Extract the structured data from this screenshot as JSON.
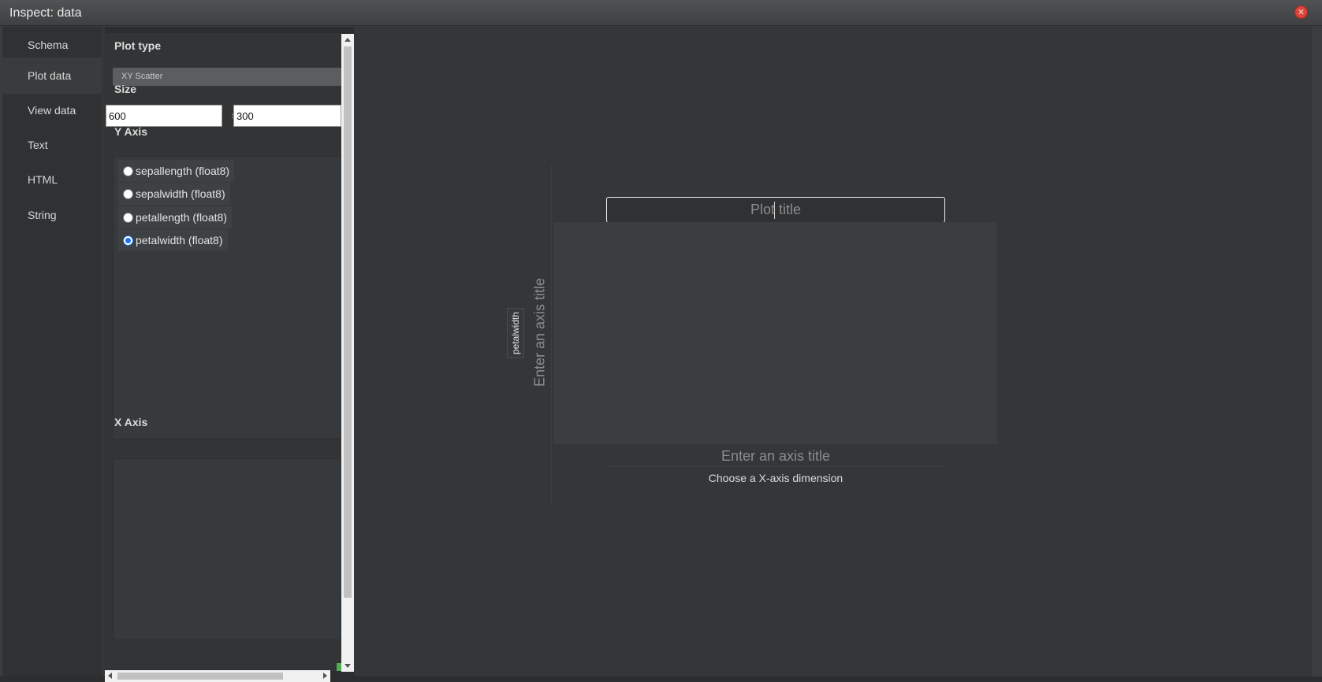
{
  "window": {
    "title": "Inspect: data",
    "close_icon": "close-icon"
  },
  "tabs": [
    {
      "label": "Schema"
    },
    {
      "label": "Plot data",
      "active": true
    },
    {
      "label": "View data"
    },
    {
      "label": "Text"
    },
    {
      "label": "HTML"
    },
    {
      "label": "String"
    }
  ],
  "panel": {
    "plot_type_label": "Plot type",
    "plot_type_value": "XY Scatter",
    "size_label": "Size",
    "width": "600",
    "height": "300",
    "times": "×",
    "y_axis_label": "Y Axis",
    "y_axis_options": [
      {
        "label": "sepallength (float8)",
        "checked": false
      },
      {
        "label": "sepalwidth (float8)",
        "checked": false
      },
      {
        "label": "petallength (float8)",
        "checked": false
      },
      {
        "label": "petalwidth (float8)",
        "checked": true
      }
    ],
    "x_axis_label": "X Axis"
  },
  "preview": {
    "plot_title_placeholder": "Plot title",
    "y_axis_title_placeholder": "Enter an axis title",
    "y_dimension": "petalwidth",
    "x_axis_title_placeholder": "Enter an axis title",
    "x_dimension_hint": "Choose a X-axis dimension"
  },
  "colors": {
    "accent": "#1a73e8",
    "close": "#d9453b"
  }
}
